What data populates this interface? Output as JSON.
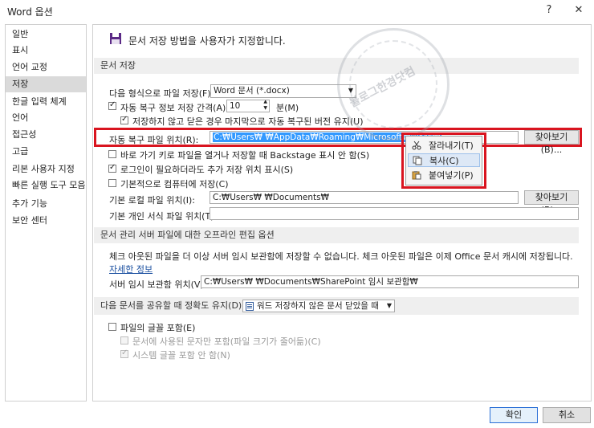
{
  "window": {
    "title": "Word 옵션",
    "help": "?",
    "close": "✕"
  },
  "sidebar": {
    "items": [
      {
        "label": "일반"
      },
      {
        "label": "표시"
      },
      {
        "label": "언어 교정"
      },
      {
        "label": "저장"
      },
      {
        "label": "한글 입력 체계"
      },
      {
        "label": "언어"
      },
      {
        "label": "접근성"
      },
      {
        "label": "고급"
      },
      {
        "label": "리본 사용자 지정"
      },
      {
        "label": "빠른 실행 도구 모음"
      },
      {
        "label": "추가 기능"
      },
      {
        "label": "보안 센터"
      }
    ],
    "selected": "저장"
  },
  "main": {
    "heading": "문서 저장 방법을 사용자가 지정합니다.",
    "save_section": {
      "header": "문서 저장",
      "format_label": "다음 형식으로 파일 저장(F):",
      "format_value": "Word 문서 (*.docx)",
      "autorecover_label": "자동 복구 정보 저장 간격(A):",
      "autorecover_value": "10",
      "minutes_label": "분(M)",
      "keep_last_label": "저장하지 않고 닫은 경우 마지막으로 자동 복구된 버전 유지(U)",
      "autorecover_path_label": "자동 복구 파일 위치(R):",
      "autorecover_path_value": "C:₩Users₩           ₩AppData₩Roaming₩Microsoft₩Word₩",
      "browse1": "찾아보기(B)...",
      "backstage_label": "바로 가기 키로 파일을 열거나 저장할 때 Backstage 표시 안 함(S)",
      "extra_locations_label": "로그인이 필요하더라도 추가 저장 위치 표시(S)",
      "default_computer_label": "기본적으로 컴퓨터에 저장(C)",
      "default_local_label": "기본 로컬 파일 위치(I):",
      "default_local_value": "C:₩Users₩            ₩Documents₩",
      "browse2": "찾아보기(B)...",
      "personal_templates_label": "기본 개인 서식 파일 위치(T):",
      "personal_templates_value": ""
    },
    "offline_section": {
      "header": "문서 관리 서버 파일에 대한 오프라인 편집 옵션",
      "description": "체크 아웃된 파일을 더 이상 서버 임시 보관함에 저장할 수 없습니다. 체크 아웃된 파일은 이제 Office 문서 캐시에 저장됩니다.",
      "more_info": "자세한 정보",
      "server_drafts_label": "서버 임시 보관함 위치(V):",
      "server_drafts_value": "C:₩Users₩            ₩Documents₩SharePoint 임시 보관함₩"
    },
    "fidelity_section": {
      "label": "다음 문서를 공유할 때 정확도 유지(D):",
      "document_value": "워드 저장하지 않은 문서 닫았을 때",
      "embed_fonts_label": "파일의 글꼴 포함(E)",
      "embed_used_chars_label": "문서에 사용된 문자만 포함(파일 크기가 줄어듦)(C)",
      "no_system_fonts_label": "시스템 글꼴 포함 안 함(N)"
    }
  },
  "context_menu": {
    "items": [
      {
        "label": "잘라내기(T)",
        "icon": "scissors-icon"
      },
      {
        "label": "복사(C)",
        "icon": "copy-icon"
      },
      {
        "label": "붙여넣기(P)",
        "icon": "paste-icon"
      }
    ]
  },
  "watermark": {
    "text": "블로그한경닷컴"
  },
  "footer": {
    "ok": "확인",
    "cancel": "취소"
  },
  "colors": {
    "highlight_border": "#d9141f",
    "selection": "#3399ff",
    "sidebar_selected": "#dadada"
  }
}
